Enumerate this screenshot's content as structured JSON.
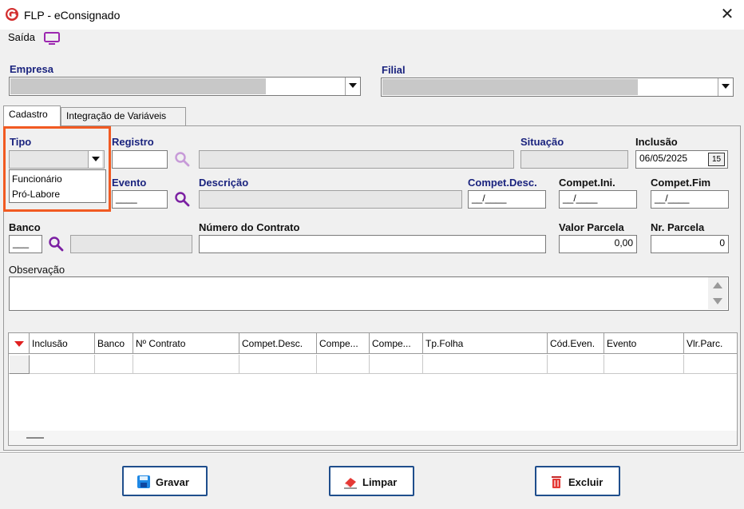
{
  "window": {
    "title": "FLP - eConsignado",
    "close_glyph": "✕"
  },
  "menu": {
    "saida_label": "Saída",
    "monitor_icon": "monitor-icon"
  },
  "header": {
    "empresa_label": "Empresa",
    "filial_label": "Filial"
  },
  "tabs": [
    {
      "label": "Cadastro",
      "active": true
    },
    {
      "label": "Integração de Variáveis",
      "active": false
    }
  ],
  "form": {
    "tipo_label": "Tipo",
    "tipo_options": [
      "Funcionário",
      "Pró-Labore"
    ],
    "registro_label": "Registro",
    "situacao_label": "Situação",
    "inclusao_label": "Inclusão",
    "inclusao_value": "06/05/2025",
    "calendar_glyph": "15",
    "evento_label": "Evento",
    "evento_value": "____",
    "descricao_label": "Descrição",
    "compet_desc_label": "Compet.Desc.",
    "compet_desc_value": "__/____",
    "compet_ini_label": "Compet.Ini.",
    "compet_ini_value": "__/____",
    "compet_fim_label": "Compet.Fim",
    "compet_fim_value": "__/____",
    "banco_label": "Banco",
    "banco_value": "___",
    "numero_contrato_label": "Número do Contrato",
    "valor_parcela_label": "Valor Parcela",
    "valor_parcela_value": "0,00",
    "nr_parcela_label": "Nr. Parcela",
    "nr_parcela_value": "0",
    "observacao_label": "Observação"
  },
  "grid": {
    "columns": [
      "Inclusão",
      "Banco",
      "Nº Contrato",
      "Compet.Desc.",
      "Compe...",
      "Compe...",
      "Tp.Folha",
      "Cód.Even.",
      "Evento",
      "Vlr.Parc."
    ]
  },
  "buttons": {
    "gravar": "Gravar",
    "limpar": "Limpar",
    "excluir": "Excluir"
  },
  "colors": {
    "label_blue": "#1a237e",
    "highlight_orange": "#f15a22",
    "button_border": "#1f4e8c",
    "search_purple": "#8e24aa"
  }
}
